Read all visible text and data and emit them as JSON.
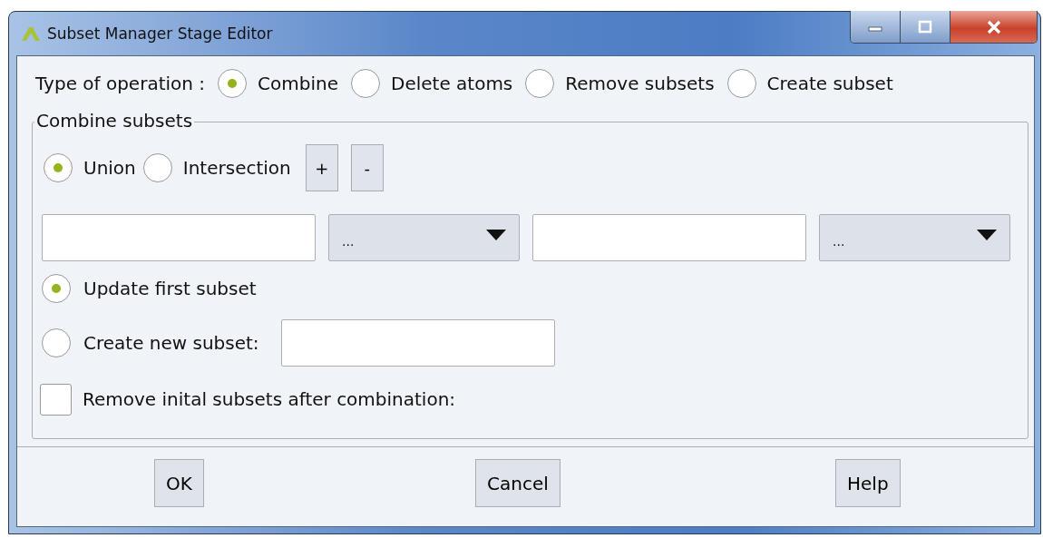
{
  "window": {
    "title": "Subset Manager Stage Editor"
  },
  "operation": {
    "label": "Type of operation :",
    "options": [
      {
        "label": "Combine",
        "selected": true
      },
      {
        "label": "Delete atoms",
        "selected": false
      },
      {
        "label": "Remove subsets",
        "selected": false
      },
      {
        "label": "Create subset",
        "selected": false
      }
    ]
  },
  "combine": {
    "title": "Combine subsets",
    "modes": [
      {
        "label": "Union",
        "selected": true
      },
      {
        "label": "Intersection",
        "selected": false
      }
    ],
    "add_button": "+",
    "remove_button": "-",
    "subset_pairs": [
      {
        "operator": "..."
      },
      {
        "operator": "..."
      }
    ],
    "targets": [
      {
        "kind": "radio",
        "label": "Update first subset",
        "selected": true
      },
      {
        "kind": "radio_field",
        "label": "Create new subset:",
        "selected": false
      }
    ],
    "remove_initial": {
      "label": "Remove inital subsets after combination:",
      "checked": false
    }
  },
  "buttons": [
    "OK",
    "Cancel",
    "Help"
  ]
}
